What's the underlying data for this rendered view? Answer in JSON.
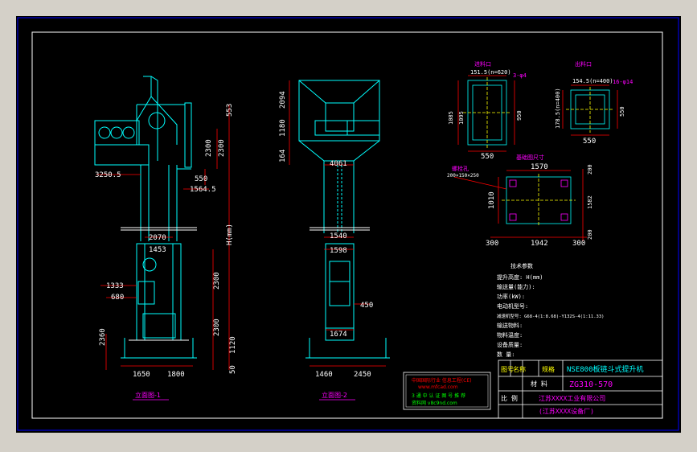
{
  "view_labels": {
    "elevation_1": "立面图-1",
    "elevation_2": "立面图-2",
    "inlet": "进料口",
    "outlet": "出料口",
    "foundation": "基础图尺寸",
    "bolt_note": "螺栓孔",
    "bolt_spec": "200×150×250"
  },
  "dims_view1": {
    "top1": "553",
    "upper1": "2300",
    "upper2": "2300",
    "d550": "550",
    "d3250": "3250.5",
    "d1564": "1564.5",
    "width_mid": "2070",
    "width_mid2": "1453",
    "height_total": "H(mm)",
    "d2300a": "2300",
    "d1333": "1333",
    "d680": "680",
    "d2300b": "2300",
    "d2360": "2360",
    "d1120": "1120",
    "d50": "50",
    "bottom_left": "1650",
    "bottom_right": "1800"
  },
  "dims_view2": {
    "top": "2094",
    "d1180": "1180",
    "d164": "164",
    "d4061": "4061",
    "d1540": "1540",
    "d1598": "1598",
    "d450": "450",
    "d1674": "1674",
    "bottom_left": "1460",
    "bottom_right": "2450"
  },
  "dims_inlet": {
    "top": "151.5(n=620)",
    "note": "3-φ4",
    "left1": "1085",
    "left2": "1095",
    "right": "950",
    "bottom": "550"
  },
  "dims_outlet": {
    "top": "154.5(n=400)",
    "note": "16-φ14",
    "left": "178.5(n=400)",
    "right": "550",
    "bottom": "550"
  },
  "dims_foundation": {
    "top": "1570",
    "left": "1010",
    "right_top": "200",
    "right_mid": "1582",
    "right_bot": "200",
    "bottom_left": "300",
    "bottom_mid": "1942",
    "bottom_right": "300"
  },
  "tech_params": {
    "title": "技术参数",
    "rows": [
      "提升高度: H(mm)",
      "输送量(能力):",
      "功率(kW):",
      "电动机型号:",
      "减速机型号: G68-4(1:8.68)-Y132S-4(1:11.33)",
      "输送物料:",
      "物料温度:",
      "设备质量:",
      "数 量:"
    ]
  },
  "stamp": {
    "line1": "中国国际行业 信息工程(CE)",
    "line2": "www.mfcad.com",
    "line3": "3 通 中 认 证 图 号 推 荐",
    "line4": "资料网 v8c9nd.com"
  },
  "title_block": {
    "col1": "图号",
    "col2": "名称",
    "col3": "规格",
    "model": "NSE800板链斗式提升机",
    "part_label": "材 料",
    "drawing_no": "ZG310-570",
    "scale_label": "比 例",
    "company": "江苏XXXX工业有限公司",
    "factory": "(江苏XXXX设备厂)"
  },
  "colors": {
    "background": "#000000",
    "frame": "#0000ff",
    "inner_frame": "#ffffff",
    "structure": "#00ffff",
    "dimension": "#ff0000",
    "annotation": "#ff00ff",
    "text": "#ffffff",
    "yellow": "#ffff00",
    "green": "#00ff00"
  }
}
